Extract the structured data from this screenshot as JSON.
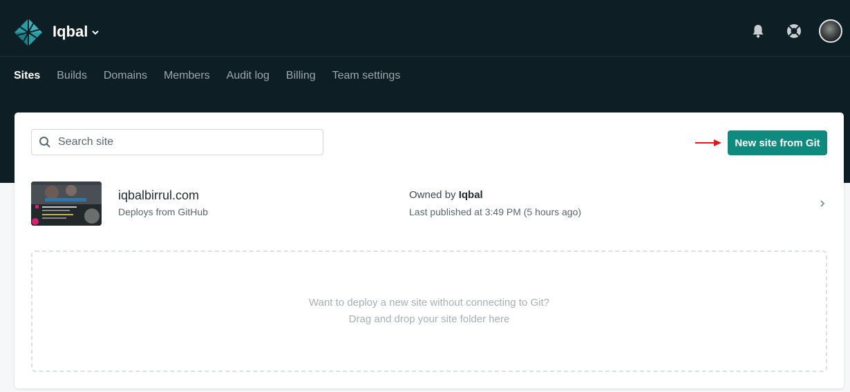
{
  "header": {
    "team_name": "Iqbal",
    "icons": [
      "netlify-logo-icon",
      "bell-icon",
      "help-lifebuoy-icon",
      "user-avatar"
    ]
  },
  "nav": {
    "items": [
      {
        "label": "Sites",
        "active": true
      },
      {
        "label": "Builds",
        "active": false
      },
      {
        "label": "Domains",
        "active": false
      },
      {
        "label": "Members",
        "active": false
      },
      {
        "label": "Audit log",
        "active": false
      },
      {
        "label": "Billing",
        "active": false
      },
      {
        "label": "Team settings",
        "active": false
      }
    ]
  },
  "search": {
    "placeholder": "Search site"
  },
  "actions": {
    "new_site_label": "New site from Git"
  },
  "sites": [
    {
      "name": "iqbalbirrul.com",
      "source": "Deploys from GitHub",
      "owner_prefix": "Owned by",
      "owner": "Iqbal",
      "published": "Last published at 3:49 PM (5 hours ago)"
    }
  ],
  "dropzone": {
    "line1": "Want to deploy a new site without connecting to Git?",
    "line2": "Drag and drop your site folder here"
  },
  "colors": {
    "header_bg": "#0e1e25",
    "primary_button": "#0e8a7f",
    "annotation_arrow": "#e8141a"
  }
}
